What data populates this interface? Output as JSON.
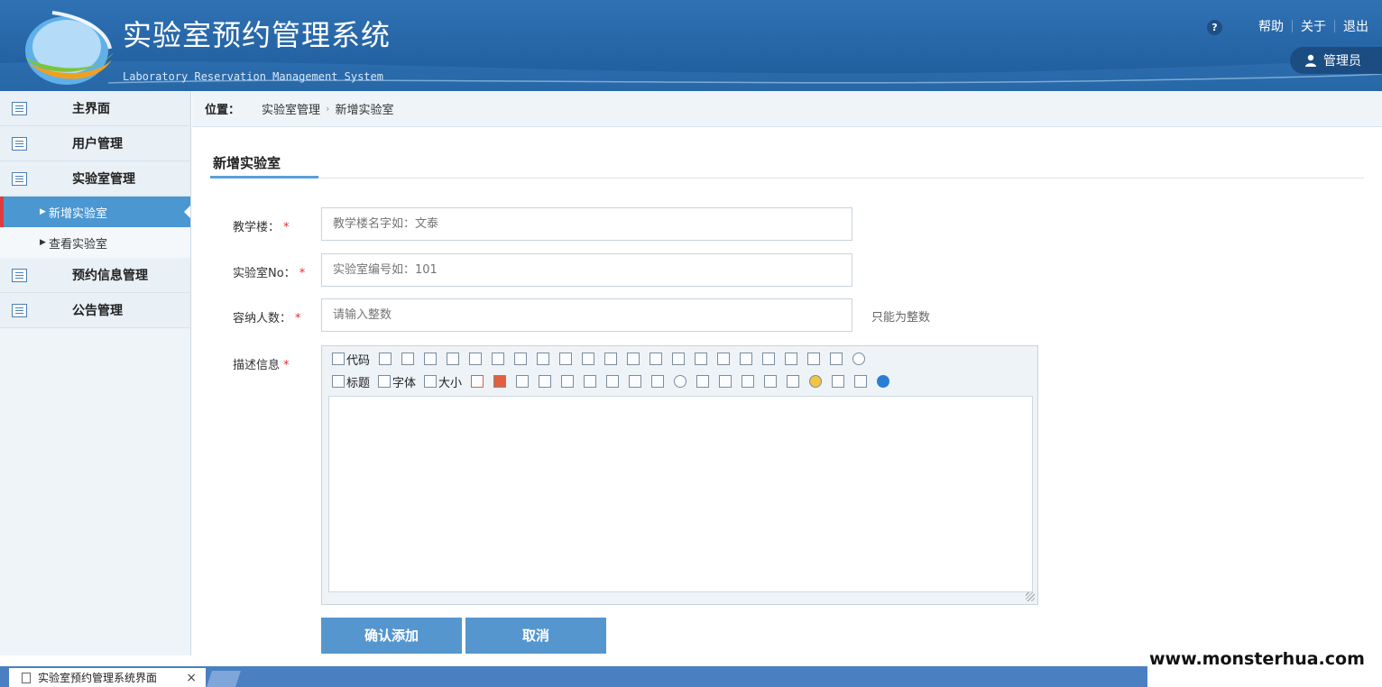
{
  "header": {
    "title": "实验室预约管理系统",
    "subtitle": "Laboratory Reservation Management System",
    "help_icon": "?",
    "links": [
      "帮助",
      "关于",
      "退出"
    ],
    "user": "管理员"
  },
  "sidebar": {
    "items": [
      {
        "label": "主界面",
        "icon": "list-icon"
      },
      {
        "label": "用户管理",
        "icon": "list-icon"
      },
      {
        "label": "实验室管理",
        "icon": "list-icon"
      }
    ],
    "sub_items": [
      {
        "label": "新增实验室",
        "active": true
      },
      {
        "label": "查看实验室",
        "active": false
      }
    ],
    "items_after": [
      {
        "label": "预约信息管理",
        "icon": "list-icon"
      },
      {
        "label": "公告管理",
        "icon": "list-icon"
      }
    ]
  },
  "breadcrumb": {
    "label": "位置：",
    "parent": "实验室管理",
    "current": "新增实验室"
  },
  "form": {
    "tab_title": "新增实验室",
    "building": {
      "label": "教学楼：",
      "placeholder": "教学楼名字如：文泰"
    },
    "lab_no": {
      "label": "实验室No：",
      "placeholder": "实验室编号如：101"
    },
    "capacity": {
      "label": "容纳人数：",
      "placeholder": "请输入整数",
      "hint": "只能为整数"
    },
    "description": {
      "label": "描述信息"
    },
    "toolbar": {
      "code": "代码",
      "heading": "标题",
      "font": "字体",
      "size": "大小"
    },
    "submit": "确认添加",
    "cancel": "取消"
  },
  "browser": {
    "tab_title": "实验室预约管理系统界面"
  },
  "watermark": "www.monsterhua.com",
  "colors": {
    "header": "#2665a6",
    "active_menu": "#4b97d2",
    "button": "#5596cf",
    "required": "#e03030"
  }
}
